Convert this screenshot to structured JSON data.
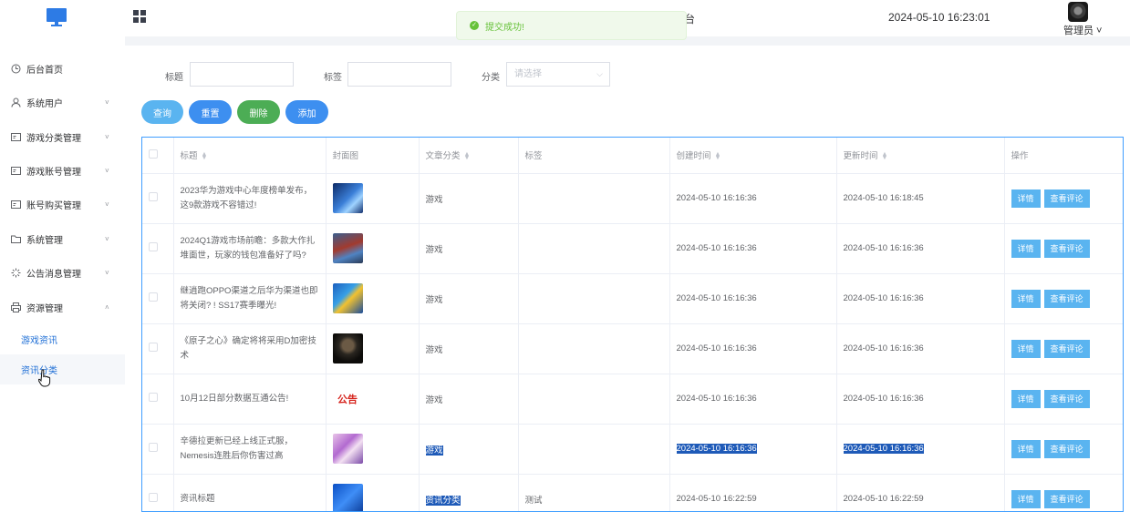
{
  "header": {
    "title_tail": "台",
    "datetime": "2024-05-10 16:23:01",
    "user_label": "管理员 ˅"
  },
  "toast": {
    "text": "提交成功!",
    "color": "#67c23a"
  },
  "sidebar": {
    "items": [
      {
        "label": "后台首页",
        "icon": "clock-icon",
        "chevron": ""
      },
      {
        "label": "系统用户",
        "icon": "user-icon",
        "chevron": "˅"
      },
      {
        "label": "游戏分类管理",
        "icon": "card-icon",
        "chevron": "˅"
      },
      {
        "label": "游戏账号管理",
        "icon": "card-icon",
        "chevron": "˅"
      },
      {
        "label": "账号购买管理",
        "icon": "card-icon",
        "chevron": "˅"
      },
      {
        "label": "系统管理",
        "icon": "folder-icon",
        "chevron": "˅"
      },
      {
        "label": "公告消息管理",
        "icon": "loading-icon",
        "chevron": "˅"
      },
      {
        "label": "资源管理",
        "icon": "printer-icon",
        "chevron": "˄"
      }
    ],
    "sub_items": [
      {
        "label": "游戏资讯"
      },
      {
        "label": "资讯分类"
      }
    ]
  },
  "filters": {
    "title_label": "标题",
    "tag_label": "标签",
    "category_label": "分类",
    "category_placeholder": "请选择",
    "category_arrow": "⌵"
  },
  "buttons": {
    "query": "查询",
    "reset": "重置",
    "delete": "删除",
    "add": "添加",
    "colors": {
      "query": "#5ab4f0",
      "reset": "#3d8ff0",
      "delete": "#4cad55",
      "add": "#3d8ff0"
    }
  },
  "table": {
    "headers": {
      "title": "标题",
      "cover": "封面图",
      "category": "文章分类",
      "tag": "标签",
      "created": "创建时间",
      "updated": "更新时间",
      "actions": "操作"
    },
    "rows": [
      {
        "title": "2023华为游戏中心年度榜单发布，这9款游戏不容错过!",
        "category": "游戏",
        "tag": "",
        "created": "2024-05-10 16:16:36",
        "updated": "2024-05-10 16:18:45",
        "cover": "game-art-blue"
      },
      {
        "title": "2024Q1游戏市场前瞻：多款大作扎堆面世，玩家的钱包准备好了吗?",
        "category": "游戏",
        "tag": "",
        "created": "2024-05-10 16:16:36",
        "updated": "2024-05-10 16:16:36",
        "cover": "game-art-red"
      },
      {
        "title": "继逍跑OPPO渠道之后华为渠道也即将关闭? ! SS17赛季曝光!",
        "category": "游戏",
        "tag": "",
        "created": "2024-05-10 16:16:36",
        "updated": "2024-05-10 16:16:36",
        "cover": "game-art-yellow"
      },
      {
        "title": "《原子之心》确定将将采用D加密技术",
        "category": "游戏",
        "tag": "",
        "created": "2024-05-10 16:16:36",
        "updated": "2024-05-10 16:16:36",
        "cover": "game-art-dark"
      },
      {
        "title": "10月12日部分数据互通公告!",
        "category": "游戏",
        "tag": "",
        "created": "2024-05-10 16:16:36",
        "updated": "2024-05-10 16:16:36",
        "cover": "notice-stamp",
        "cover_text": "公告"
      },
      {
        "title": "辛德拉更新已经上线正式服，Nemesis连胜后你伤害过高",
        "category": "游戏",
        "tag": "",
        "created": "2024-05-10 16:16:36",
        "updated": "2024-05-10 16:16:36",
        "cover": "game-art-pink"
      },
      {
        "title": "资讯标题",
        "category": "资讯分类",
        "tag": "测试",
        "created": "2024-05-10 16:22:59",
        "updated": "2024-05-10 16:22:59",
        "cover": "game-art-cube"
      }
    ],
    "detail_label": "详情",
    "comment_label": "查看评论"
  }
}
